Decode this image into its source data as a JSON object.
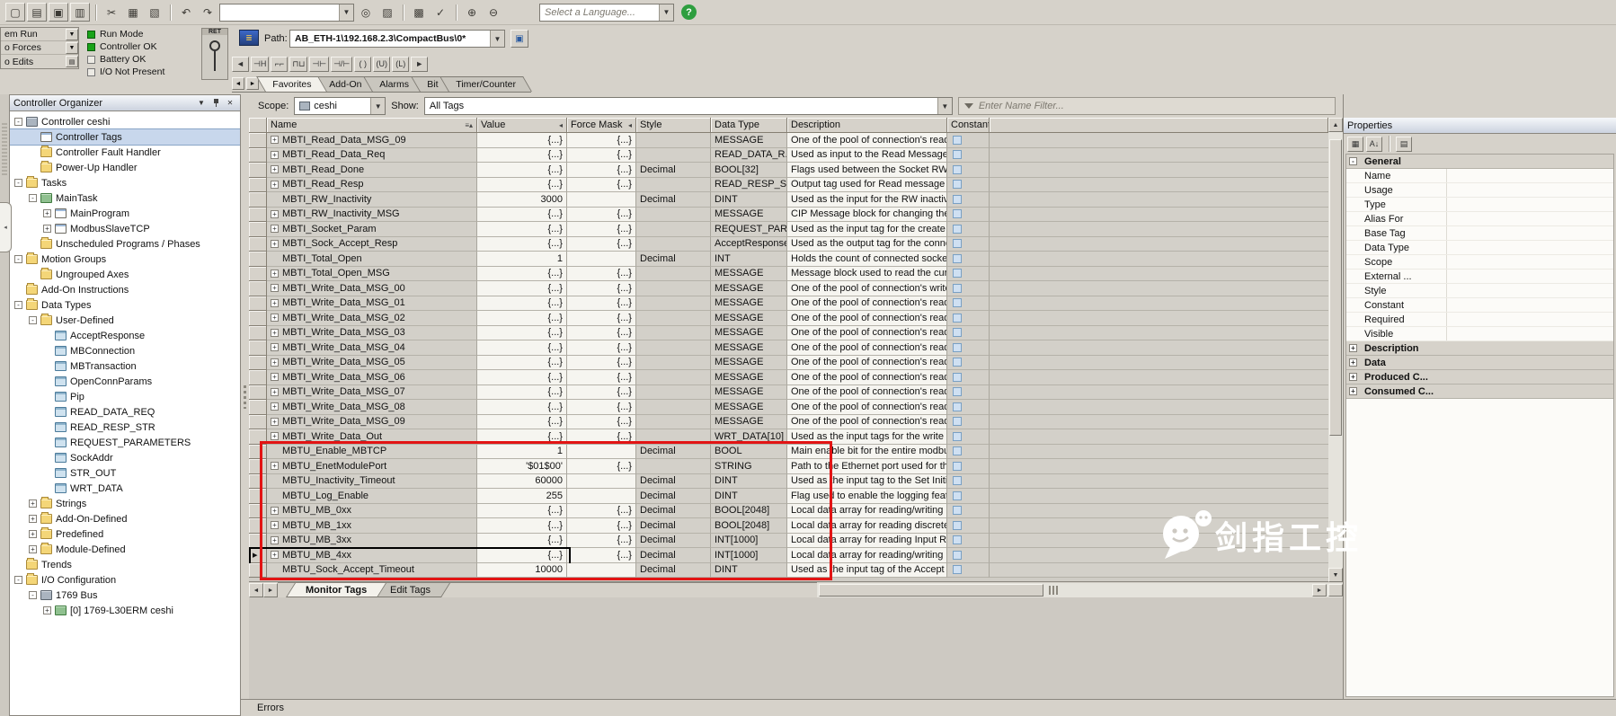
{
  "icons": {
    "new": "▢",
    "open": "▤",
    "save": "▣",
    "print": "▥",
    "cut": "✂",
    "copy": "▦",
    "paste": "▧",
    "undo": "↶",
    "redo": "↷",
    "find": "◎",
    "select": "▨",
    "grid": "▩",
    "check": "✓",
    "zoomin": "⊕",
    "zoomout": "⊖",
    "net": "▣",
    "pathmod": "≣",
    "dd": "▼",
    "up": "▲",
    "down": "▼",
    "left": "◄",
    "right": "►",
    "menu": "▼",
    "close": "✕",
    "categorized": "▦",
    "alphabetical": "A↓",
    "proppage": "▤"
  },
  "toolbar1": {
    "language_placeholder": "Select a Language...",
    "help_label": "?"
  },
  "status": {
    "modes": [
      "em Run",
      "o Forces",
      "o Edits"
    ],
    "indicators": [
      {
        "label": "Run Mode",
        "on": true
      },
      {
        "label": "Controller OK",
        "on": true
      },
      {
        "label": "Battery OK",
        "on": false
      },
      {
        "label": "I/O Not Present",
        "on": false
      }
    ],
    "ret": "RET",
    "path_label": "Path:",
    "path_value": "AB_ETH-1\\192.168.2.3\\CompactBus\\0*"
  },
  "instr": {
    "buttons": [
      {
        "g": "◄",
        "n": "palette-scroll-left"
      },
      {
        "g": "⊣H",
        "n": "branch"
      },
      {
        "g": "⌐⌐",
        "n": "rung-up"
      },
      {
        "g": "⊓⊔",
        "n": "rung"
      },
      {
        "g": "⊣⊢",
        "n": "xic-instruction"
      },
      {
        "g": "⊣/⊢",
        "n": "xio-instruction"
      },
      {
        "g": "( )",
        "n": "ote-instruction"
      },
      {
        "g": "(U)",
        "n": "otu-instruction"
      },
      {
        "g": "(L)",
        "n": "otl-instruction"
      },
      {
        "g": "►",
        "n": "palette-scroll-right"
      }
    ],
    "tabs": [
      "Favorites",
      "Add-On",
      "Alarms",
      "Bit",
      "Timer/Counter"
    ],
    "active_tab": "Favorites"
  },
  "organizer": {
    "title": "Controller Organizer",
    "items": [
      {
        "l": "Controller ceshi",
        "lv": 0,
        "exp": "-",
        "ic": "chip",
        "icn": "controller-icon"
      },
      {
        "l": "Controller Tags",
        "lv": 1,
        "exp": null,
        "ic": "page",
        "icn": "tags-icon",
        "sel": true
      },
      {
        "l": "Controller Fault Handler",
        "lv": 1,
        "exp": null,
        "ic": "folder",
        "icn": "folder-icon"
      },
      {
        "l": "Power-Up Handler",
        "lv": 1,
        "exp": null,
        "ic": "folder",
        "icn": "folder-icon"
      },
      {
        "l": "Tasks",
        "lv": 0,
        "exp": "-",
        "ic": "folder",
        "icn": "folder-icon"
      },
      {
        "l": "MainTask",
        "lv": 1,
        "exp": "-",
        "ic": "green",
        "icn": "task-icon"
      },
      {
        "l": "MainProgram",
        "lv": 2,
        "exp": "+",
        "ic": "page",
        "icn": "program-icon"
      },
      {
        "l": "ModbusSlaveTCP",
        "lv": 2,
        "exp": "+",
        "ic": "page",
        "icn": "program-icon"
      },
      {
        "l": "Unscheduled Programs / Phases",
        "lv": 1,
        "exp": null,
        "ic": "folder",
        "icn": "folder-icon"
      },
      {
        "l": "Motion Groups",
        "lv": 0,
        "exp": "-",
        "ic": "folder",
        "icn": "folder-icon"
      },
      {
        "l": "Ungrouped Axes",
        "lv": 1,
        "exp": null,
        "ic": "folder",
        "icn": "folder-icon"
      },
      {
        "l": "Add-On Instructions",
        "lv": 0,
        "exp": null,
        "ic": "folder",
        "icn": "folder-icon"
      },
      {
        "l": "Data Types",
        "lv": 0,
        "exp": "-",
        "ic": "folder",
        "icn": "folder-icon"
      },
      {
        "l": "User-Defined",
        "lv": 1,
        "exp": "-",
        "ic": "folder",
        "icn": "folder-icon"
      },
      {
        "l": "AcceptResponse",
        "lv": 2,
        "exp": null,
        "ic": "grid",
        "icn": "udt-icon"
      },
      {
        "l": "MBConnection",
        "lv": 2,
        "exp": null,
        "ic": "grid",
        "icn": "udt-icon"
      },
      {
        "l": "MBTransaction",
        "lv": 2,
        "exp": null,
        "ic": "grid",
        "icn": "udt-icon"
      },
      {
        "l": "OpenConnParams",
        "lv": 2,
        "exp": null,
        "ic": "grid",
        "icn": "udt-icon"
      },
      {
        "l": "Pip",
        "lv": 2,
        "exp": null,
        "ic": "grid",
        "icn": "udt-icon"
      },
      {
        "l": "READ_DATA_REQ",
        "lv": 2,
        "exp": null,
        "ic": "grid",
        "icn": "udt-icon"
      },
      {
        "l": "READ_RESP_STR",
        "lv": 2,
        "exp": null,
        "ic": "grid",
        "icn": "udt-icon"
      },
      {
        "l": "REQUEST_PARAMETERS",
        "lv": 2,
        "exp": null,
        "ic": "grid",
        "icn": "udt-icon"
      },
      {
        "l": "SockAddr",
        "lv": 2,
        "exp": null,
        "ic": "grid",
        "icn": "udt-icon"
      },
      {
        "l": "STR_OUT",
        "lv": 2,
        "exp": null,
        "ic": "grid",
        "icn": "udt-icon"
      },
      {
        "l": "WRT_DATA",
        "lv": 2,
        "exp": null,
        "ic": "grid",
        "icn": "udt-icon"
      },
      {
        "l": "Strings",
        "lv": 1,
        "exp": "+",
        "ic": "folder",
        "icn": "folder-icon"
      },
      {
        "l": "Add-On-Defined",
        "lv": 1,
        "exp": "+",
        "ic": "folder",
        "icn": "folder-icon"
      },
      {
        "l": "Predefined",
        "lv": 1,
        "exp": "+",
        "ic": "folder",
        "icn": "folder-icon"
      },
      {
        "l": "Module-Defined",
        "lv": 1,
        "exp": "+",
        "ic": "folder",
        "icn": "folder-icon"
      },
      {
        "l": "Trends",
        "lv": 0,
        "exp": null,
        "ic": "folder",
        "icn": "folder-icon"
      },
      {
        "l": "I/O Configuration",
        "lv": 0,
        "exp": "-",
        "ic": "folder",
        "icn": "folder-icon"
      },
      {
        "l": "1769 Bus",
        "lv": 1,
        "exp": "-",
        "ic": "chip",
        "icn": "bus-icon"
      },
      {
        "l": "[0] 1769-L30ERM ceshi",
        "lv": 2,
        "exp": "+",
        "ic": "green",
        "icn": "module-icon"
      }
    ]
  },
  "tag_editor": {
    "scope_label": "Scope:",
    "scope_value": "ceshi",
    "show_label": "Show:",
    "show_value": "All Tags",
    "filter_placeholder": "Enter Name Filter...",
    "columns": [
      {
        "label": "Name",
        "icon": "≡▴"
      },
      {
        "label": "Value",
        "icon": "◂"
      },
      {
        "label": "Force Mask",
        "icon": "◂"
      },
      {
        "label": "Style",
        "icon": ""
      },
      {
        "label": "Data Type",
        "icon": ""
      },
      {
        "label": "Description",
        "icon": ""
      },
      {
        "label": "Constant",
        "icon": ""
      }
    ],
    "rows": [
      {
        "n": "MBTI_Read_Data_MSG_09",
        "e": 1,
        "v": "{...}",
        "f": "{...}",
        "s": "",
        "t": "MESSAGE",
        "d": "One of the pool of connection's read ..."
      },
      {
        "n": "MBTI_Read_Data_Req",
        "e": 1,
        "v": "{...}",
        "f": "{...}",
        "s": "",
        "t": "READ_DATA_R...",
        "d": "Used as input to the Read Message ..."
      },
      {
        "n": "MBTI_Read_Done",
        "e": 1,
        "v": "{...}",
        "f": "{...}",
        "s": "Decimal",
        "t": "BOOL[32]",
        "d": "Flags used between the Socket RW ..."
      },
      {
        "n": "MBTI_Read_Resp",
        "e": 1,
        "v": "{...}",
        "f": "{...}",
        "s": "",
        "t": "READ_RESP_S...",
        "d": "Output tag used for Read message b..."
      },
      {
        "n": "MBTI_RW_Inactivity",
        "e": 0,
        "v": "3000",
        "f": "",
        "s": "Decimal",
        "t": "DINT",
        "d": "Used as the input for the RW inactivi..."
      },
      {
        "n": "MBTI_RW_Inactivity_MSG",
        "e": 1,
        "v": "{...}",
        "f": "{...}",
        "s": "",
        "t": "MESSAGE",
        "d": "CIP Message block for changing the ..."
      },
      {
        "n": "MBTI_Socket_Param",
        "e": 1,
        "v": "{...}",
        "f": "{...}",
        "s": "",
        "t": "REQUEST_PAR...",
        "d": "Used as the input tag for the create s..."
      },
      {
        "n": "MBTI_Sock_Accept_Resp",
        "e": 1,
        "v": "{...}",
        "f": "{...}",
        "s": "",
        "t": "AcceptResponse",
        "d": "Used as the output tag for the conne..."
      },
      {
        "n": "MBTI_Total_Open",
        "e": 0,
        "v": "1",
        "f": "",
        "s": "Decimal",
        "t": "INT",
        "d": "Holds the count of connected socke..."
      },
      {
        "n": "MBTI_Total_Open_MSG",
        "e": 1,
        "v": "{...}",
        "f": "{...}",
        "s": "",
        "t": "MESSAGE",
        "d": "Message block used to read the curr..."
      },
      {
        "n": "MBTI_Write_Data_MSG_00",
        "e": 1,
        "v": "{...}",
        "f": "{...}",
        "s": "",
        "t": "MESSAGE",
        "d": "One of the pool of connection's write..."
      },
      {
        "n": "MBTI_Write_Data_MSG_01",
        "e": 1,
        "v": "{...}",
        "f": "{...}",
        "s": "",
        "t": "MESSAGE",
        "d": "One of the pool of connection's read ..."
      },
      {
        "n": "MBTI_Write_Data_MSG_02",
        "e": 1,
        "v": "{...}",
        "f": "{...}",
        "s": "",
        "t": "MESSAGE",
        "d": "One of the pool of connection's read ..."
      },
      {
        "n": "MBTI_Write_Data_MSG_03",
        "e": 1,
        "v": "{...}",
        "f": "{...}",
        "s": "",
        "t": "MESSAGE",
        "d": "One of the pool of connection's read ..."
      },
      {
        "n": "MBTI_Write_Data_MSG_04",
        "e": 1,
        "v": "{...}",
        "f": "{...}",
        "s": "",
        "t": "MESSAGE",
        "d": "One of the pool of connection's read ..."
      },
      {
        "n": "MBTI_Write_Data_MSG_05",
        "e": 1,
        "v": "{...}",
        "f": "{...}",
        "s": "",
        "t": "MESSAGE",
        "d": "One of the pool of connection's read ..."
      },
      {
        "n": "MBTI_Write_Data_MSG_06",
        "e": 1,
        "v": "{...}",
        "f": "{...}",
        "s": "",
        "t": "MESSAGE",
        "d": "One of the pool of connection's read ..."
      },
      {
        "n": "MBTI_Write_Data_MSG_07",
        "e": 1,
        "v": "{...}",
        "f": "{...}",
        "s": "",
        "t": "MESSAGE",
        "d": "One of the pool of connection's read ..."
      },
      {
        "n": "MBTI_Write_Data_MSG_08",
        "e": 1,
        "v": "{...}",
        "f": "{...}",
        "s": "",
        "t": "MESSAGE",
        "d": "One of the pool of connection's read ..."
      },
      {
        "n": "MBTI_Write_Data_MSG_09",
        "e": 1,
        "v": "{...}",
        "f": "{...}",
        "s": "",
        "t": "MESSAGE",
        "d": "One of the pool of connection's read ..."
      },
      {
        "n": "MBTI_Write_Data_Out",
        "e": 1,
        "v": "{...}",
        "f": "{...}",
        "s": "",
        "t": "WRT_DATA[10]",
        "d": "Used as the input tags for the write m..."
      },
      {
        "n": "MBTU_Enable_MBTCP",
        "e": 0,
        "v": "1",
        "f": "",
        "s": "Decimal",
        "t": "BOOL",
        "d": "Main enable bit for the entire modbus..."
      },
      {
        "n": "MBTU_EnetModulePort",
        "e": 1,
        "v": "'$01$00'",
        "f": "{...}",
        "s": "",
        "t": "STRING",
        "d": "Path to the Ethernet port used for the..."
      },
      {
        "n": "MBTU_Inactivity_Timeout",
        "e": 0,
        "v": "60000",
        "f": "",
        "s": "Decimal",
        "t": "DINT",
        "d": "Used as the input tag to the Set Initi..."
      },
      {
        "n": "MBTU_Log_Enable",
        "e": 0,
        "v": "255",
        "f": "",
        "s": "Decimal",
        "t": "DINT",
        "d": "Flag used to enable the logging featu..."
      },
      {
        "n": "MBTU_MB_0xx",
        "e": 1,
        "v": "{...}",
        "f": "{...}",
        "s": "Decimal",
        "t": "BOOL[2048]",
        "d": "Local data array for reading/writing ..."
      },
      {
        "n": "MBTU_MB_1xx",
        "e": 1,
        "v": "{...}",
        "f": "{...}",
        "s": "Decimal",
        "t": "BOOL[2048]",
        "d": "Local data array for reading discrete..."
      },
      {
        "n": "MBTU_MB_3xx",
        "e": 1,
        "v": "{...}",
        "f": "{...}",
        "s": "Decimal",
        "t": "INT[1000]",
        "d": "Local data array for reading Input Re..."
      },
      {
        "n": "MBTU_MB_4xx",
        "e": 1,
        "v": "{...}",
        "f": "{...}",
        "s": "Decimal",
        "t": "INT[1000]",
        "d": "Local data array for reading/writing ...",
        "sel": true
      },
      {
        "n": "MBTU_Sock_Accept_Timeout",
        "e": 0,
        "v": "10000",
        "f": "",
        "s": "Decimal",
        "t": "DINT",
        "d": "Used as the input tag of the Accept ..."
      }
    ],
    "tabs": [
      "Monitor Tags",
      "Edit Tags"
    ],
    "active_tab": "Monitor Tags"
  },
  "properties": {
    "title": "Properties",
    "rows": [
      {
        "kind": "cat",
        "exp": "-",
        "label": "General"
      },
      {
        "kind": "item",
        "label": "Name"
      },
      {
        "kind": "item",
        "label": "Usage"
      },
      {
        "kind": "item",
        "label": "Type"
      },
      {
        "kind": "item",
        "label": "Alias For"
      },
      {
        "kind": "item",
        "label": "Base Tag"
      },
      {
        "kind": "item",
        "label": "Data Type"
      },
      {
        "kind": "item",
        "label": "Scope"
      },
      {
        "kind": "item",
        "label": "External ..."
      },
      {
        "kind": "item",
        "label": "Style"
      },
      {
        "kind": "item",
        "label": "Constant"
      },
      {
        "kind": "item",
        "label": "Required"
      },
      {
        "kind": "item",
        "label": "Visible"
      },
      {
        "kind": "cat",
        "exp": "+",
        "label": "Description"
      },
      {
        "kind": "cat",
        "exp": "+",
        "label": "Data"
      },
      {
        "kind": "cat",
        "exp": "+",
        "label": "Produced C..."
      },
      {
        "kind": "cat",
        "exp": "+",
        "label": "Consumed C..."
      }
    ]
  },
  "errors": {
    "title": "Errors"
  },
  "watermark": {
    "text": "剑指工控"
  }
}
